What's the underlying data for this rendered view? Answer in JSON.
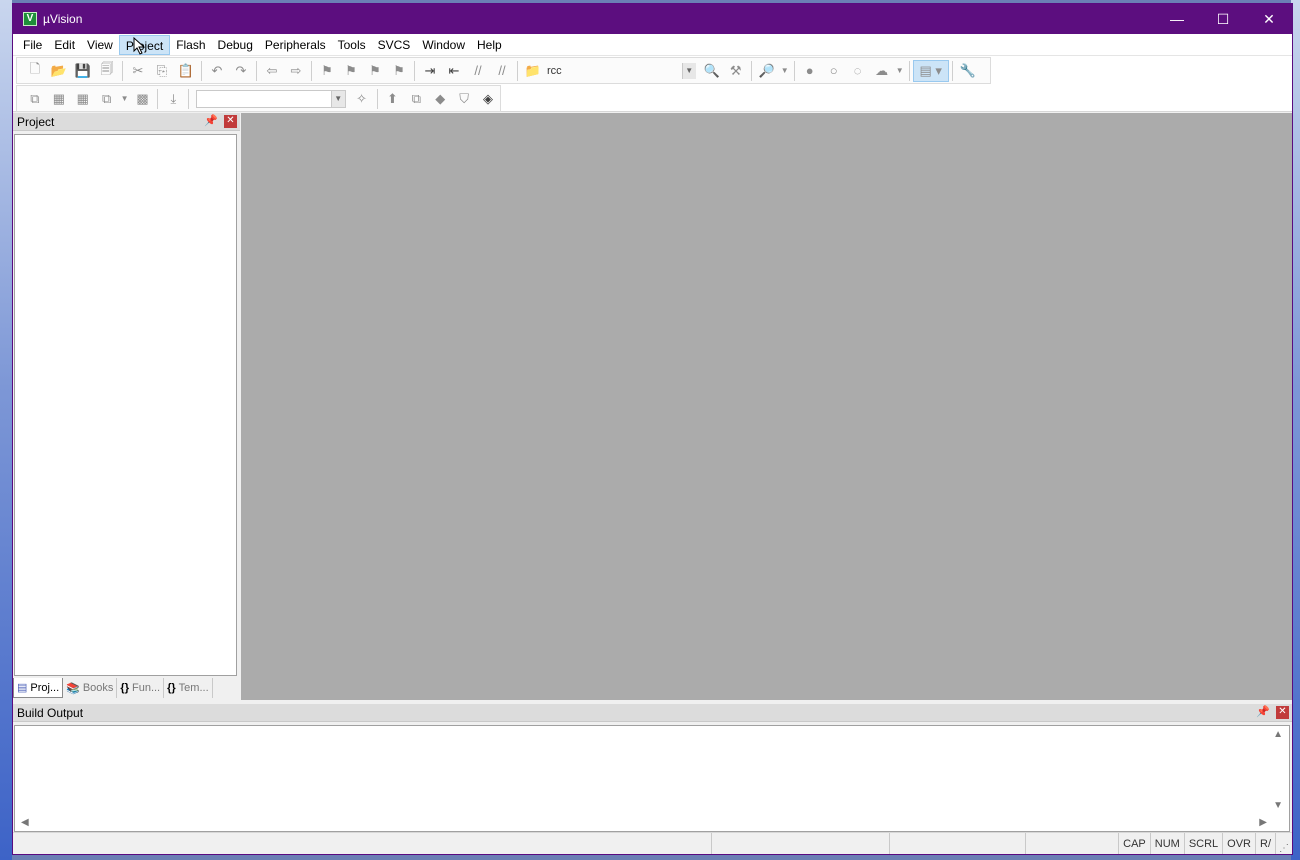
{
  "window": {
    "title": "µVision",
    "controls": {
      "minimize": "—",
      "maximize": "☐",
      "close": "✕"
    }
  },
  "menu": {
    "items": [
      "File",
      "Edit",
      "View",
      "Project",
      "Flash",
      "Debug",
      "Peripherals",
      "Tools",
      "SVCS",
      "Window",
      "Help"
    ],
    "active": "Project"
  },
  "toolbar": {
    "find_text": "rcc"
  },
  "project_pane": {
    "title": "Project",
    "tabs": [
      {
        "label": "Proj...",
        "icon": "project-tab-icon"
      },
      {
        "label": "Books",
        "icon": "books-icon"
      },
      {
        "label": "Fun...",
        "icon": "functions-icon"
      },
      {
        "label": "Tem...",
        "icon": "templates-icon"
      }
    ]
  },
  "build_output": {
    "title": "Build Output",
    "content": ""
  },
  "statusbar": {
    "keys": [
      "CAP",
      "NUM",
      "SCRL",
      "OVR",
      "R/"
    ]
  },
  "colors": {
    "titlebar": "#5c0e7f",
    "editor_bg": "#ababab",
    "menu_active": "#cce4f7"
  }
}
